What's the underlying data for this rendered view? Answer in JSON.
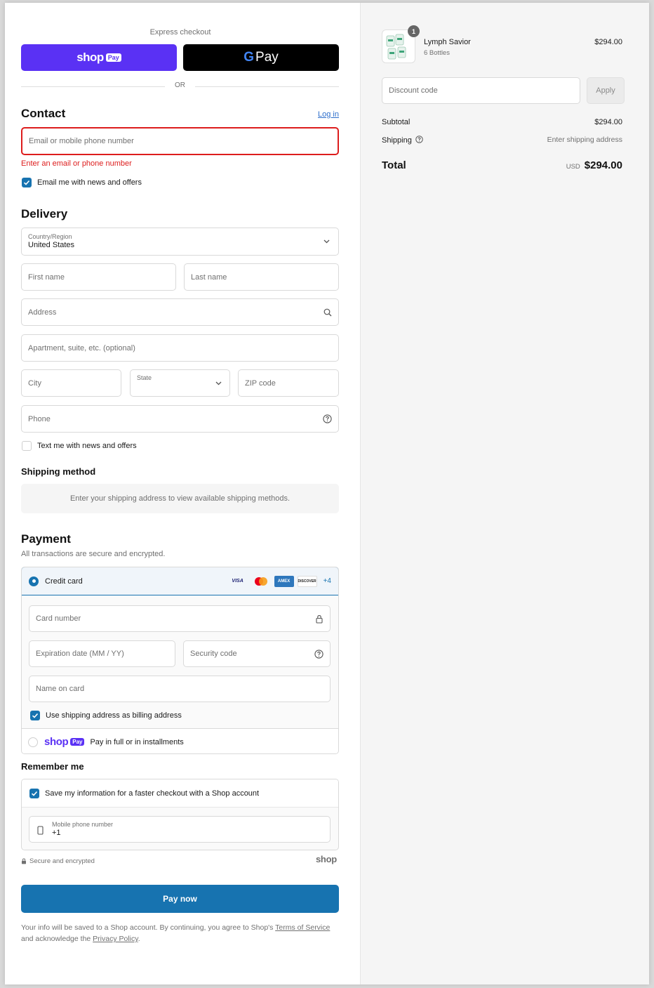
{
  "express": {
    "title": "Express checkout",
    "shop_pay": {
      "word": "shop",
      "pill": "Pay"
    },
    "gpay": {
      "g": "G",
      "word": "Pay"
    },
    "or": "OR"
  },
  "contact": {
    "heading": "Contact",
    "login": "Log in",
    "email_placeholder": "Email or mobile phone number",
    "error": "Enter an email or phone number",
    "newsletter": "Email me with news and offers"
  },
  "delivery": {
    "heading": "Delivery",
    "country_label": "Country/Region",
    "country_value": "United States",
    "first_name": "First name",
    "last_name": "Last name",
    "address": "Address",
    "apartment": "Apartment, suite, etc. (optional)",
    "city": "City",
    "state": "State",
    "zip": "ZIP code",
    "phone": "Phone",
    "text_offers": "Text me with news and offers"
  },
  "shipping_method": {
    "heading": "Shipping method",
    "info": "Enter your shipping address to view available shipping methods."
  },
  "payment": {
    "heading": "Payment",
    "subtitle": "All transactions are secure and encrypted.",
    "credit_card": "Credit card",
    "brands": [
      "VISA",
      "",
      "AMEX",
      "DISCOVER"
    ],
    "more_brands": "+4",
    "card_number": "Card number",
    "expiration": "Expiration date (MM / YY)",
    "security_code": "Security code",
    "name_on_card": "Name on card",
    "billing_same": "Use shipping address as billing address",
    "shop_word": "shop",
    "shop_pill": "Pay",
    "shop_installments": "Pay in full or in installments"
  },
  "remember": {
    "heading": "Remember me",
    "save_info": "Save my information for a faster checkout with a Shop account",
    "mobile_label": "Mobile phone number",
    "mobile_value": "+1",
    "secure": "Secure and encrypted",
    "shop_logo": "shop"
  },
  "pay_now": "Pay now",
  "legal": {
    "text_before": "Your info will be saved to a Shop account. By continuing, you agree to Shop's ",
    "terms": "Terms of Service",
    "text_mid": " and acknowledge the ",
    "privacy": "Privacy Policy",
    "text_end": "."
  },
  "summary": {
    "quantity": "1",
    "product_name": "Lymph Savior",
    "product_variant": "6 Bottles",
    "product_price": "$294.00",
    "discount_placeholder": "Discount code",
    "apply": "Apply",
    "subtotal_label": "Subtotal",
    "subtotal_value": "$294.00",
    "shipping_label": "Shipping",
    "shipping_value": "Enter shipping address",
    "total_label": "Total",
    "currency": "USD",
    "total_value": "$294.00"
  },
  "colors": {
    "primary": "#1773b0",
    "shop_purple": "#5a31f4",
    "error": "#dd1d1d"
  }
}
